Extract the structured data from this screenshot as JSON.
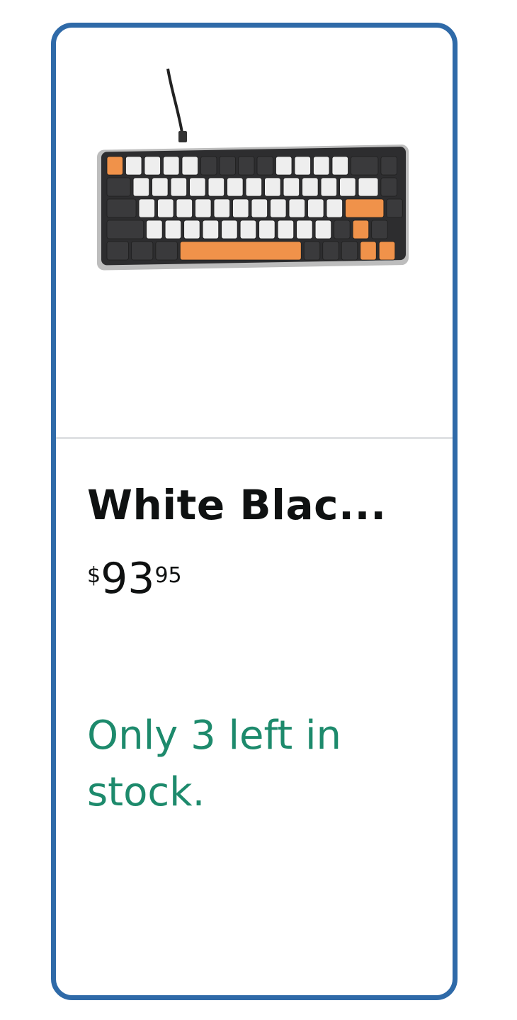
{
  "product_card": {
    "image_icon": "mechanical-keyboard-image",
    "title": "White Blac...",
    "price": {
      "symbol": "$",
      "whole": "93",
      "fraction": "95"
    },
    "stock_message": "Only 3 left in stock."
  },
  "colors": {
    "card_border": "#2f6aa8",
    "stock_text": "#1d8a6c",
    "title_text": "#0f1111",
    "keyboard_dark": "#3a3a3c",
    "keyboard_light": "#eeeeee",
    "keyboard_accent": "#f0924a"
  }
}
